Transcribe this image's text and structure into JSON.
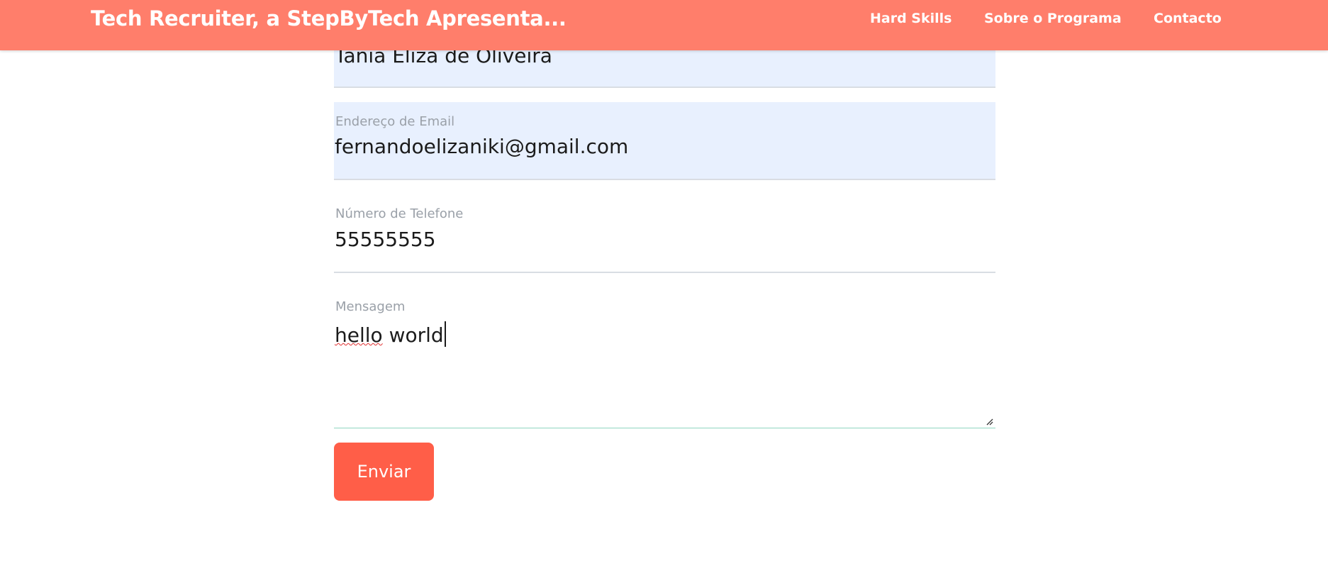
{
  "navbar": {
    "brand": "Tech Recruiter, a StepByTech Apresenta...",
    "links": [
      "Hard Skills",
      "Sobre o Programa",
      "Contacto"
    ]
  },
  "form": {
    "name": {
      "value": "Tania Eliza de Oliveira"
    },
    "email": {
      "label": "Endereço de Email",
      "value": "fernandoelizaniki@gmail.com"
    },
    "phone": {
      "label": "Número de Telefone",
      "value": "55555555"
    },
    "message": {
      "label": "Mensagem",
      "value_word1": "hello",
      "value_rest": " world"
    },
    "submit_label": "Enviar"
  },
  "colors": {
    "navbar": "#ff7e6b",
    "button": "#ff5e48",
    "autofill": "#e8f0fe"
  }
}
